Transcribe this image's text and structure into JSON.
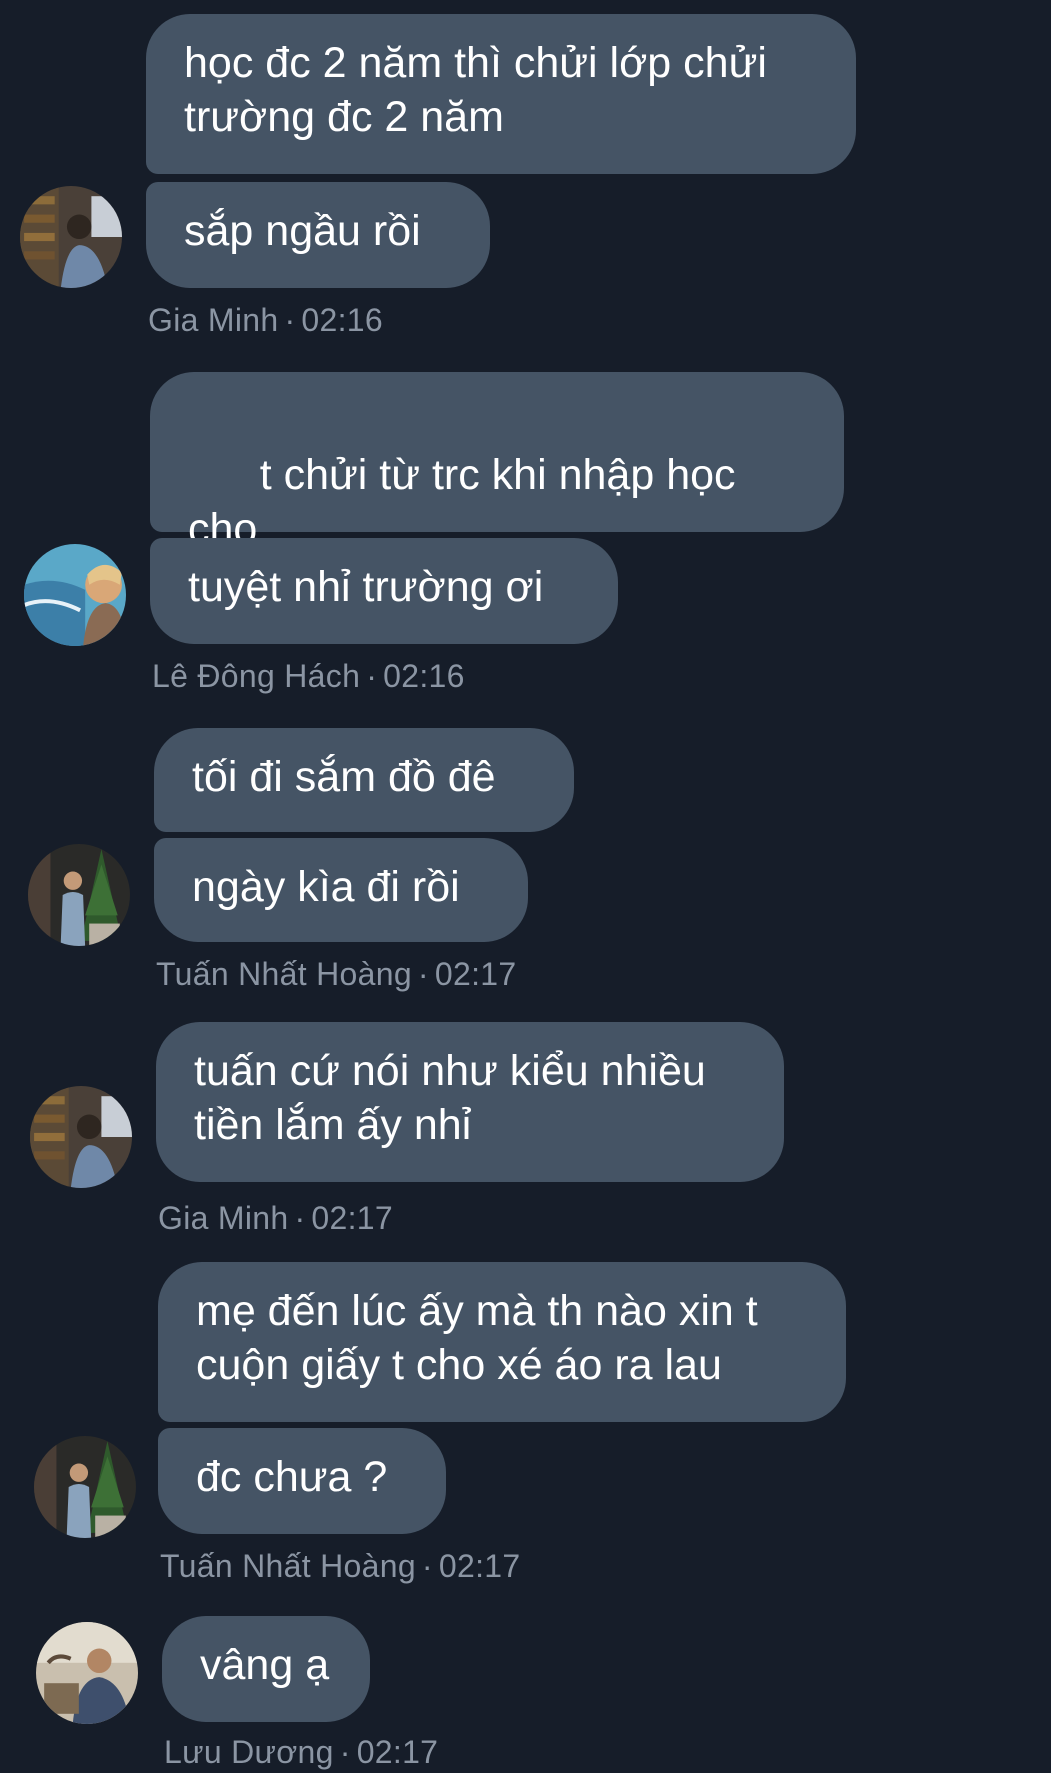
{
  "messages": [
    {
      "sender": "Gia Minh",
      "time": "02:16",
      "avatar": "gia-minh-avatar",
      "bubbles": [
        "học đc 2 năm thì chửi lớp chửi\ntrường đc 2 năm",
        "sắp ngầu rồi"
      ]
    },
    {
      "sender": "Lê Đông Hách",
      "time": "02:16",
      "avatar": "le-dong-hach-avatar",
      "bubbles": [
        "t chửi từ trc khi nhập học cho\nđến giờ",
        "tuyệt nhỉ trường ơi"
      ],
      "emoji": "🥰"
    },
    {
      "sender": "Tuấn Nhất Hoàng",
      "time": "02:17",
      "avatar": "tuan-nhat-hoang-avatar",
      "bubbles": [
        "tối đi sắm đồ đê",
        "ngày kìa đi rồi"
      ]
    },
    {
      "sender": "Gia Minh",
      "time": "02:17",
      "avatar": "gia-minh-avatar",
      "bubbles": [
        "tuấn cứ nói như kiểu nhiều\ntiền lắm ấy nhỉ"
      ]
    },
    {
      "sender": "Tuấn Nhất Hoàng",
      "time": "02:17",
      "avatar": "tuan-nhat-hoang-avatar",
      "bubbles": [
        "mẹ đến lúc ấy mà th nào xin t\ncuộn giấy t cho xé áo ra lau",
        "đc chưa ?"
      ]
    },
    {
      "sender": "Lưu Dương",
      "time": "02:17",
      "avatar": "luu-duong-avatar",
      "bubbles": [
        "vâng ạ"
      ]
    }
  ],
  "separator": "·",
  "colors": {
    "background": "#161d29",
    "bubble": "#455465",
    "meta_text": "#8b95a3"
  }
}
